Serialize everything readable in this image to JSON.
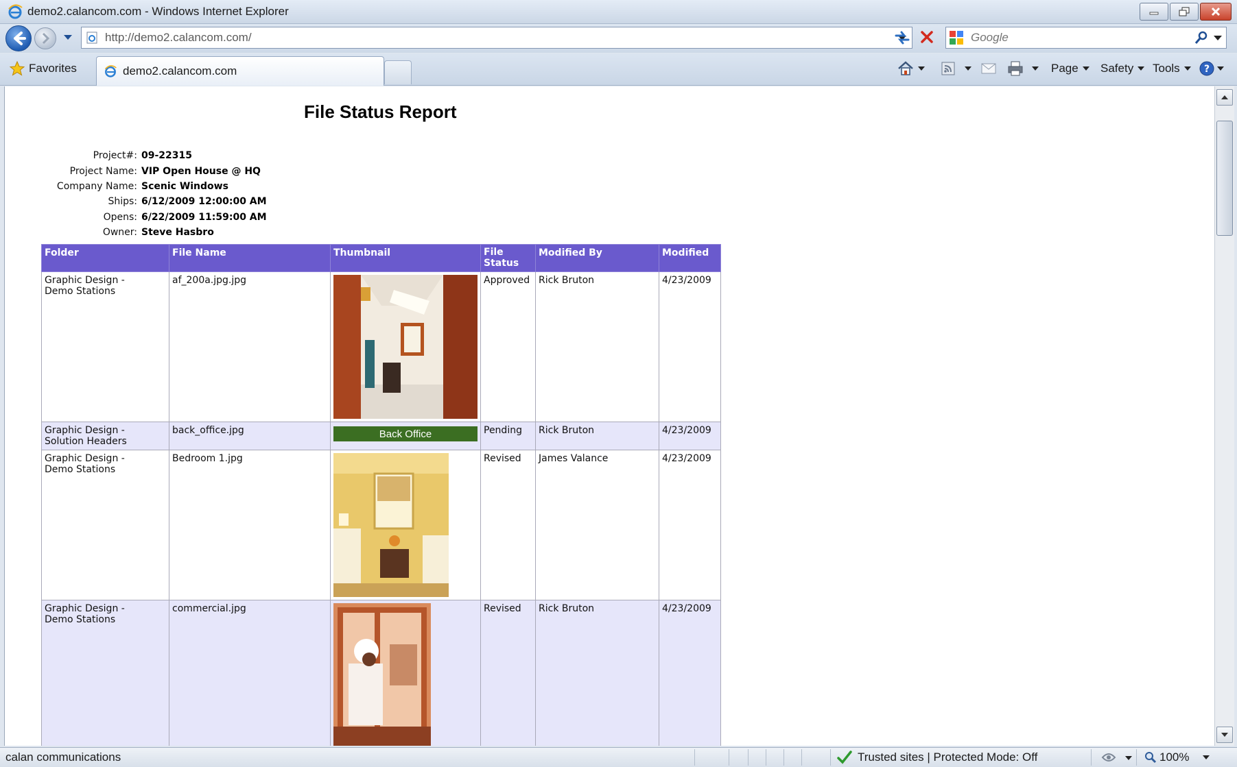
{
  "window": {
    "title": "demo2.calancom.com - Windows Internet Explorer"
  },
  "address_bar": {
    "url": "http://demo2.calancom.com/"
  },
  "search": {
    "placeholder": "Google"
  },
  "command_bar": {
    "favorites_label": "Favorites",
    "tab_title": "demo2.calancom.com",
    "page_label": "Page",
    "safety_label": "Safety",
    "tools_label": "Tools"
  },
  "report": {
    "title": "File Status Report",
    "info": [
      {
        "label": "Project#:",
        "value": "09-22315"
      },
      {
        "label": "Project Name:",
        "value": "VIP Open House @ HQ"
      },
      {
        "label": "Company Name:",
        "value": "Scenic Windows"
      },
      {
        "label": "Ships:",
        "value": "6/12/2009 12:00:00 AM"
      },
      {
        "label": "Opens:",
        "value": "6/22/2009 11:59:00 AM"
      },
      {
        "label": "Owner:",
        "value": "Steve Hasbro"
      }
    ],
    "columns": {
      "folder": "Folder",
      "file_name": "File Name",
      "thumbnail": "Thumbnail",
      "file_status_line1": "File",
      "file_status_line2": "Status",
      "modified_by": "Modified By",
      "modified": "Modified"
    },
    "rows": [
      {
        "folder_line1": "Graphic Design -",
        "folder_line2": "Demo Stations",
        "file_name": "af_200a.jpg.jpg",
        "status": "Approved",
        "modified_by": "Rick Bruton",
        "modified": "4/23/2009"
      },
      {
        "folder_line1": "Graphic Design -",
        "folder_line2": "Solution Headers",
        "file_name": "back_office.jpg",
        "thumbnail_text": "Back Office",
        "status": "Pending",
        "modified_by": "Rick Bruton",
        "modified": "4/23/2009"
      },
      {
        "folder_line1": "Graphic Design -",
        "folder_line2": "Demo Stations",
        "file_name": "Bedroom 1.jpg",
        "status": "Revised",
        "modified_by": "James Valance",
        "modified": "4/23/2009"
      },
      {
        "folder_line1": "Graphic Design -",
        "folder_line2": "Demo Stations",
        "file_name": "commercial.jpg",
        "status": "Revised",
        "modified_by": "Rick Bruton",
        "modified": "4/23/2009"
      }
    ]
  },
  "status_bar": {
    "text": "calan communications",
    "zone": "Trusted sites | Protected Mode: Off",
    "zoom": "100%"
  },
  "colors": {
    "header_purple": "#6a5acd",
    "row_lavender": "#e6e6fa",
    "thumbnail_bar_green": "#3b6e22"
  }
}
